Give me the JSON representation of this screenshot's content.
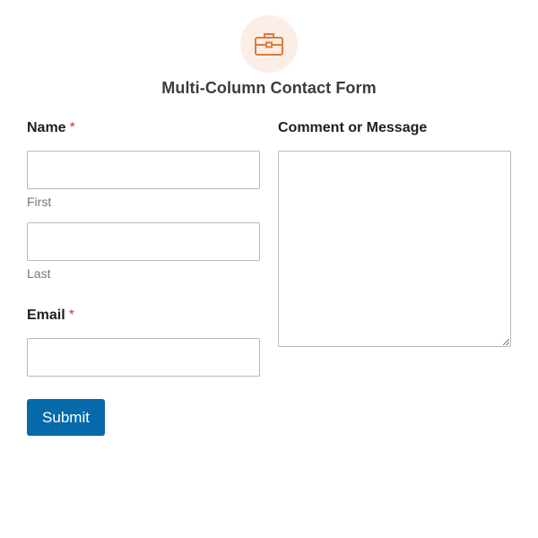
{
  "header": {
    "icon": "briefcase-icon",
    "icon_color": "#e07b39",
    "icon_bg": "#fbeee6",
    "title": "Multi-Column Contact Form"
  },
  "form": {
    "name": {
      "label": "Name",
      "required_mark": "*",
      "first": {
        "value": "",
        "placeholder": "",
        "sublabel": "First"
      },
      "last": {
        "value": "",
        "placeholder": "",
        "sublabel": "Last"
      }
    },
    "email": {
      "label": "Email",
      "required_mark": "*",
      "value": "",
      "placeholder": ""
    },
    "message": {
      "label": "Comment or Message",
      "value": "",
      "placeholder": ""
    },
    "submit_label": "Submit"
  },
  "colors": {
    "accent": "#066aab",
    "required": "#d63638",
    "border": "#b8b8b8"
  }
}
